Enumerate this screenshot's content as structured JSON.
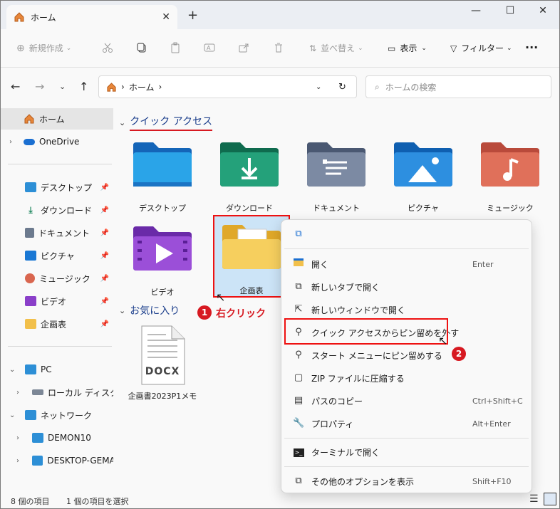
{
  "window": {
    "tab_title": "ホーム",
    "new_tab": "+",
    "minimize": "—",
    "maximize": "☐",
    "close": "✕"
  },
  "toolbar": {
    "new": "新規作成",
    "sort": "並べ替え",
    "view": "表示",
    "filter": "フィルター",
    "more": "···"
  },
  "address": {
    "home": "ホーム",
    "sep": "›",
    "search_placeholder": "ホームの検索"
  },
  "sidebar": {
    "home": "ホーム",
    "onedrive": "OneDrive",
    "pinned": [
      "デスクトップ",
      "ダウンロード",
      "ドキュメント",
      "ピクチャ",
      "ミュージック",
      "ビデオ",
      "企画表"
    ],
    "pc": "PC",
    "local_disk": "ローカル ディスク (C:)",
    "network": "ネットワーク",
    "net_items": [
      "DEMON10",
      "DESKTOP-GEMAV"
    ]
  },
  "main": {
    "quick_access": "クイック アクセス",
    "favorites": "お気に入り",
    "folders": [
      "デスクトップ",
      "ダウンロード",
      "ドキュメント",
      "ピクチャ",
      "ミュージック",
      "ビデオ",
      "企画表"
    ],
    "fav_file": "企画書2023P1メモ",
    "fav_file_ext": "DOCX"
  },
  "annotations": {
    "step1_num": "1",
    "step1_text": "右クリック",
    "step2_num": "2"
  },
  "context_menu": {
    "open": {
      "label": "開く",
      "shortcut": "Enter"
    },
    "open_tab": {
      "label": "新しいタブで開く"
    },
    "open_window": {
      "label": "新しいウィンドウで開く"
    },
    "unpin": {
      "label": "クイック アクセスからピン留めを外す"
    },
    "pin_start": {
      "label": "スタート メニューにピン留めする"
    },
    "zip": {
      "label": "ZIP ファイルに圧縮する"
    },
    "copy_path": {
      "label": "パスのコピー",
      "shortcut": "Ctrl+Shift+C"
    },
    "properties": {
      "label": "プロパティ",
      "shortcut": "Alt+Enter"
    },
    "terminal": {
      "label": "ターミナルで開く"
    },
    "more_options": {
      "label": "その他のオプションを表示",
      "shortcut": "Shift+F10"
    }
  },
  "status": {
    "count": "8 個の項目",
    "selected": "1 個の項目を選択"
  },
  "colors": {
    "accent_red": "#d71921",
    "link_blue": "#1c3f8c"
  }
}
